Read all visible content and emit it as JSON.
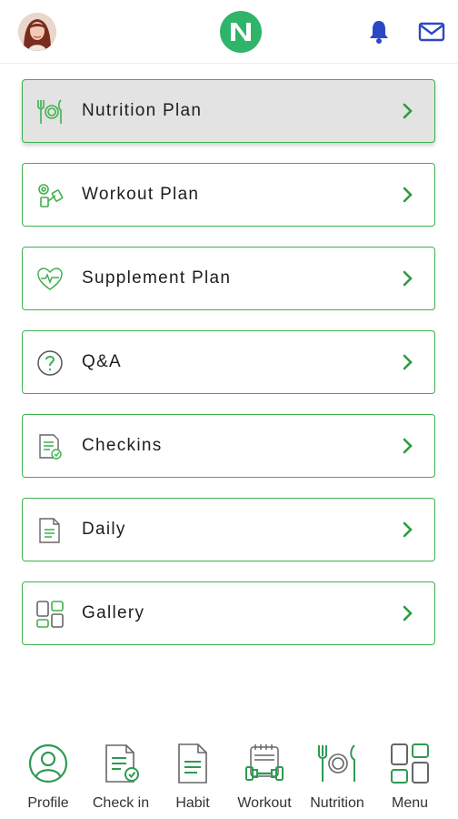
{
  "header": {
    "avatar_icon": "user-avatar-photo",
    "logo_icon": "n-logo-icon",
    "bell_icon": "bell-icon",
    "mail_icon": "mail-icon"
  },
  "colors": {
    "accent_green": "#3fb14d",
    "logo_green": "#2fb56a",
    "header_icon_blue": "#2b48c8",
    "active_row_bg": "#e3e3e3"
  },
  "menu": {
    "items": [
      {
        "label": "Nutrition Plan",
        "icon": "plate-cutlery-icon",
        "active": true
      },
      {
        "label": "Workout Plan",
        "icon": "dumbbell-icon",
        "active": false
      },
      {
        "label": "Supplement Plan",
        "icon": "heartbeat-icon",
        "active": false
      },
      {
        "label": "Q&A",
        "icon": "question-icon",
        "active": false
      },
      {
        "label": "Checkins",
        "icon": "checklist-icon",
        "active": false
      },
      {
        "label": "Daily",
        "icon": "document-icon",
        "active": false
      },
      {
        "label": "Gallery",
        "icon": "gallery-icon",
        "active": false
      }
    ]
  },
  "bottom_nav": {
    "items": [
      {
        "label": "Profile",
        "icon": "profile-icon"
      },
      {
        "label": "Check in",
        "icon": "check-in-icon"
      },
      {
        "label": "Habit",
        "icon": "habit-icon"
      },
      {
        "label": "Workout",
        "icon": "workout-icon"
      },
      {
        "label": "Nutrition",
        "icon": "nutrition-icon"
      },
      {
        "label": "Menu",
        "icon": "menu-grid-icon"
      }
    ]
  }
}
